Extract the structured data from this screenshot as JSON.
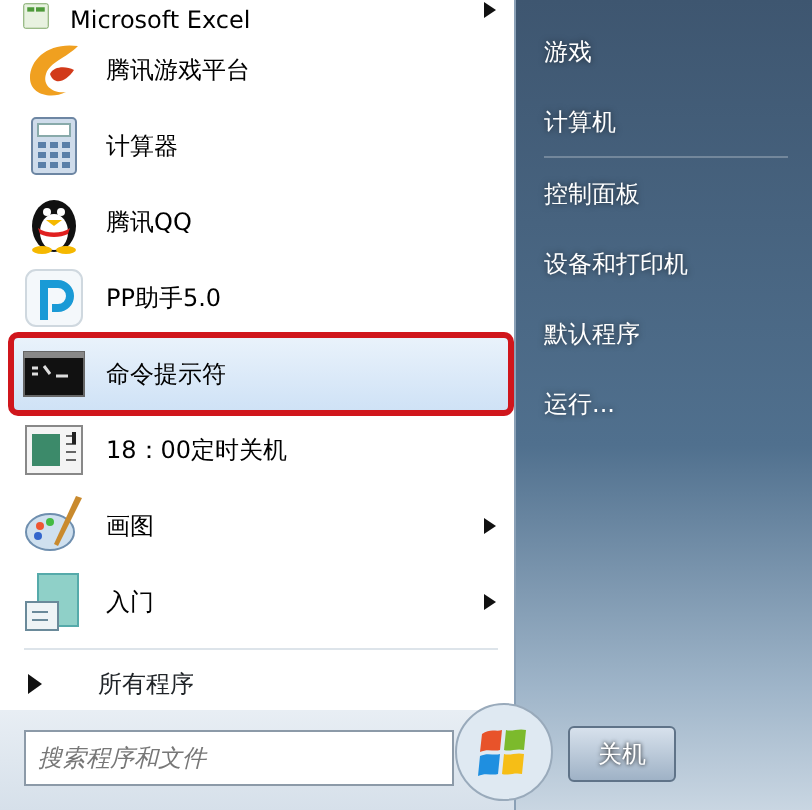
{
  "programs": [
    {
      "label": "Microsoft Excel",
      "kind": "spreadsheet",
      "submenu": true,
      "selected": false,
      "annotated": false
    },
    {
      "label": "腾讯游戏平台",
      "kind": "swirl",
      "submenu": false,
      "selected": false,
      "annotated": false
    },
    {
      "label": "计算器",
      "kind": "calculator",
      "submenu": false,
      "selected": false,
      "annotated": false
    },
    {
      "label": "腾讯QQ",
      "kind": "penguin",
      "submenu": false,
      "selected": false,
      "annotated": false
    },
    {
      "label": "PP助手5.0",
      "kind": "letter-p",
      "submenu": false,
      "selected": false,
      "annotated": false
    },
    {
      "label": "命令提示符",
      "kind": "terminal",
      "submenu": false,
      "selected": true,
      "annotated": true
    },
    {
      "label": "18：00定时关机",
      "kind": "document",
      "submenu": false,
      "selected": false,
      "annotated": false
    },
    {
      "label": "画图",
      "kind": "palette",
      "submenu": true,
      "selected": false,
      "annotated": false
    },
    {
      "label": "入门",
      "kind": "getting-started",
      "submenu": true,
      "selected": false,
      "annotated": false
    }
  ],
  "all_programs": {
    "label": "所有程序"
  },
  "search": {
    "placeholder": "搜索程序和文件"
  },
  "right_links": [
    {
      "label": "游戏",
      "divider_after": false
    },
    {
      "label": "计算机",
      "divider_after": true
    },
    {
      "label": "控制面板",
      "divider_after": false
    },
    {
      "label": "设备和打印机",
      "divider_after": false
    },
    {
      "label": "默认程序",
      "divider_after": false
    },
    {
      "label": "运行...",
      "divider_after": false
    }
  ],
  "shutdown": {
    "label": "关机"
  }
}
